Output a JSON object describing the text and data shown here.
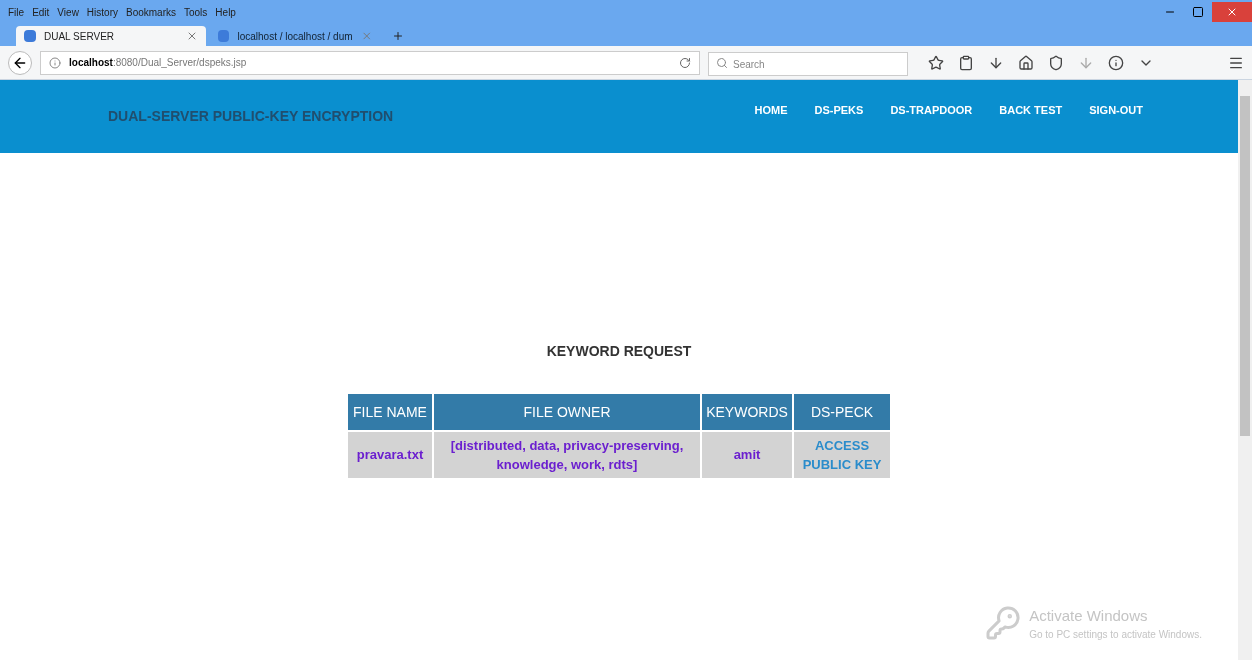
{
  "menu": [
    "File",
    "Edit",
    "View",
    "History",
    "Bookmarks",
    "Tools",
    "Help"
  ],
  "tabs": [
    {
      "label": "DUAL SERVER",
      "selected": true
    },
    {
      "label": "localhost / localhost / dum",
      "selected": false
    }
  ],
  "address": {
    "host": "localhost",
    "path": ":8080/Dual_Server/dspeks.jsp"
  },
  "search": {
    "placeholder": "Search"
  },
  "site": {
    "title": "DUAL-SERVER PUBLIC-KEY ENCRYPTION",
    "nav": [
      "HOME",
      "DS-PEKS",
      "DS-TRAPDOOR",
      "BACK TEST",
      "SIGN-OUT"
    ]
  },
  "heading": "KEYWORD REQUEST",
  "table": {
    "columns": [
      "FILE NAME",
      "FILE OWNER",
      "KEYWORDS",
      "DS-PECK"
    ],
    "rows": [
      {
        "file_name": "pravara.txt",
        "file_owner": "[distributed, data, privacy-preserving, knowledge, work, rdts]",
        "keywords": "amit",
        "action": "ACCESS PUBLIC KEY"
      }
    ]
  },
  "activation": {
    "title": "Activate Windows",
    "text": "Go to PC settings to activate Windows."
  }
}
